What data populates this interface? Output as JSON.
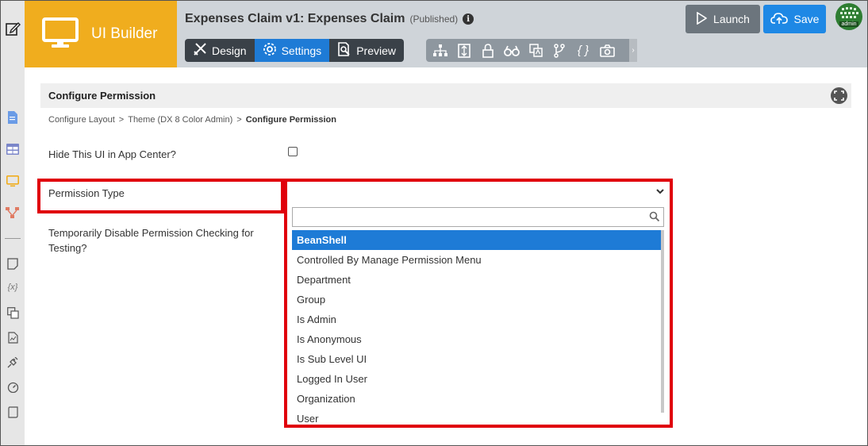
{
  "header": {
    "brand_title": "UI Builder",
    "app_title": "Expenses Claim v1: Expenses Claim",
    "app_status": "(Published)",
    "modes": [
      {
        "label": "Design",
        "icon": "design-icon",
        "active": false
      },
      {
        "label": "Settings",
        "icon": "gear-icon",
        "active": true
      },
      {
        "label": "Preview",
        "icon": "preview-icon",
        "active": false
      }
    ],
    "tools": [
      "tree-icon",
      "fit-icon",
      "lock-icon",
      "binoculars-icon",
      "translate-icon",
      "branch-icon",
      "braces-icon",
      "camera-icon"
    ],
    "launch_label": "Launch",
    "save_label": "Save",
    "avatar_label": "admin"
  },
  "rail": {
    "icons": [
      "edit-icon",
      "document-icon",
      "table-icon",
      "monitor-icon",
      "hierarchy-icon",
      "note-icon",
      "variable-icon",
      "translate-icon",
      "chart-icon",
      "plugin-icon",
      "dashboard-icon",
      "script-icon"
    ]
  },
  "panel": {
    "title": "Configure Permission",
    "breadcrumb": [
      {
        "label": "Configure Layout"
      },
      {
        "label": ">"
      },
      {
        "label": "Theme (DX 8 Color Admin)"
      },
      {
        "label": ">"
      },
      {
        "label": "Configure Permission"
      }
    ]
  },
  "form": {
    "hide_label": "Hide This UI in App Center?",
    "permission_type_label": "Permission Type",
    "disable_label_line1": "Temporarily Disable Permission Checking for",
    "disable_label_line2": "Testing?",
    "dropdown": {
      "search_placeholder": "",
      "options": [
        "BeanShell",
        "Controlled By Manage Permission Menu",
        "Department",
        "Group",
        "Is Admin",
        "Is Anonymous",
        "Is Sub Level UI",
        "Logged In User",
        "Organization",
        "User"
      ],
      "selected_index": 0
    }
  },
  "colors": {
    "brand": "#f0ad1e",
    "active_mode": "#1e7bd6",
    "highlight": "#e0000b",
    "save": "#1e88e5",
    "launch": "#6c757d"
  }
}
